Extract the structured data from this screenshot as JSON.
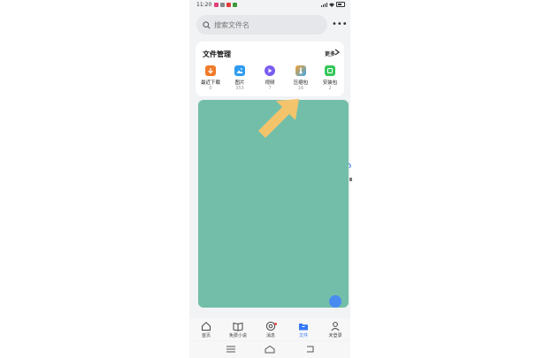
{
  "status_bar": {
    "time": "11:20"
  },
  "search": {
    "placeholder": "搜索文件名"
  },
  "file_manager": {
    "title": "文件管理",
    "more_label": "更多",
    "categories": [
      {
        "label": "最近下载",
        "count": "0",
        "color": "#f07a2a",
        "icon": "download-icon"
      },
      {
        "label": "图片",
        "count": "353",
        "color": "#2e9cf0",
        "icon": "image-icon"
      },
      {
        "label": "视频",
        "count": "7",
        "color": "#7b5cf0",
        "icon": "play-icon"
      },
      {
        "label": "压缩包",
        "count": "16",
        "color": "#f5a030",
        "icon": "archive-icon"
      },
      {
        "label": "安装包",
        "count": "2",
        "color": "#34c759",
        "icon": "package-icon"
      }
    ]
  },
  "bottom_nav": {
    "items": [
      {
        "label": "首页",
        "active": false,
        "icon": "home-icon"
      },
      {
        "label": "免费小说",
        "active": false,
        "icon": "book-icon"
      },
      {
        "label": "消息",
        "active": false,
        "icon": "message-icon"
      },
      {
        "label": "文件",
        "active": true,
        "icon": "folder-icon"
      },
      {
        "label": "未登录",
        "active": false,
        "icon": "user-icon"
      }
    ]
  },
  "colors": {
    "overlay": "#73bea9",
    "arrow": "#f4c46c",
    "accent": "#3478f6"
  }
}
